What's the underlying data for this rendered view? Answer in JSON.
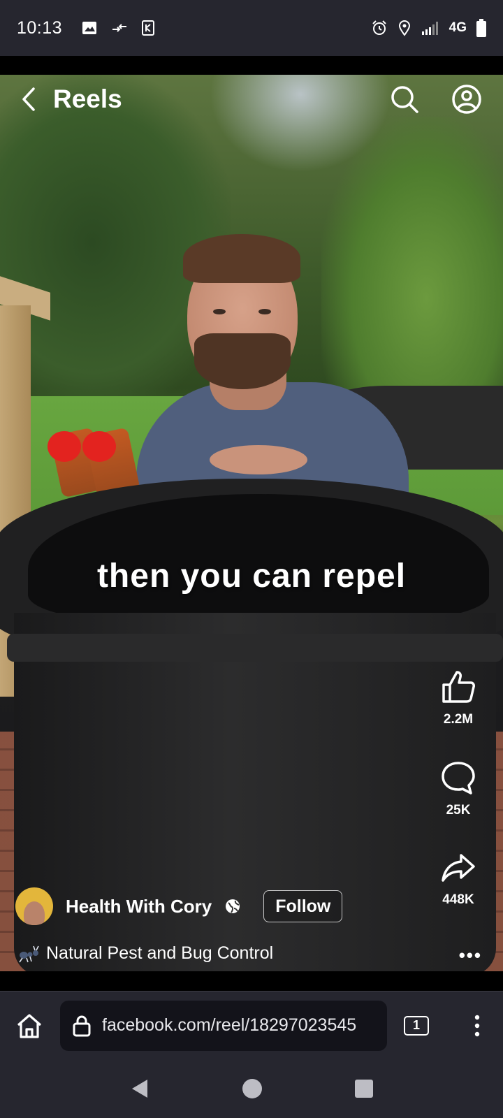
{
  "status_bar": {
    "time": "10:13",
    "network": "4G",
    "icons": [
      "image-icon",
      "data-transfer-icon",
      "app-notification-icon",
      "alarm-icon",
      "location-icon",
      "signal-icon",
      "battery-icon"
    ]
  },
  "header": {
    "title": "Reels",
    "icons": [
      "back-arrow-icon",
      "search-icon",
      "profile-icon"
    ]
  },
  "video": {
    "caption": "then you can repel"
  },
  "actions": {
    "like_count": "2.2M",
    "comment_count": "25K",
    "share_count": "448K"
  },
  "author": {
    "name": "Health With Cory",
    "follow_label": "Follow",
    "subtitle": "Natural Pest and Bug Control",
    "subtitle_icon": "ant-icon",
    "more_label": "•••"
  },
  "browser": {
    "url": "facebook.com/reel/18297023545",
    "tab_count": "1"
  },
  "colors": {
    "system_bar": "#26262f",
    "url_field": "#13131a",
    "avatar_bg": "#e3b63b"
  }
}
